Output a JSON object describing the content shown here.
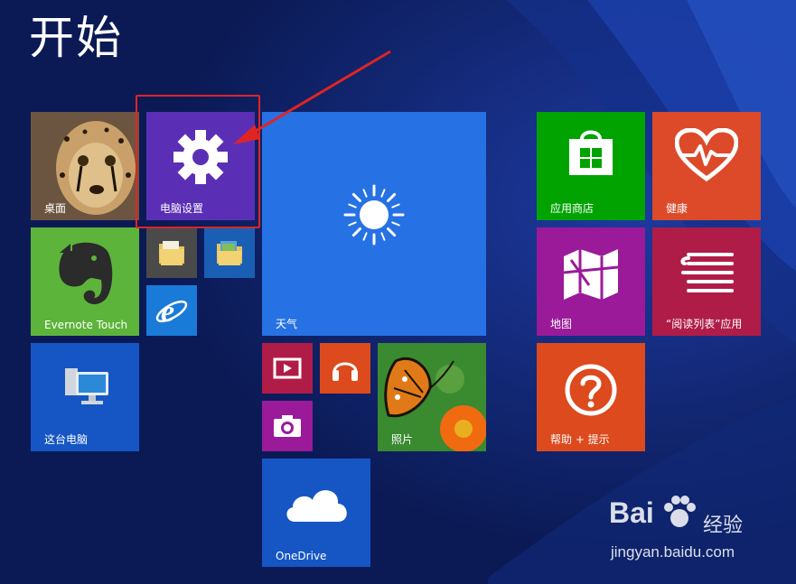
{
  "screen": {
    "title": "开始"
  },
  "tiles": {
    "desktop": {
      "label": "桌面",
      "color": "#5a4a3a"
    },
    "pc_settings": {
      "label": "电脑设置",
      "color": "#5b2fb5"
    },
    "weather": {
      "label": "天气",
      "color": "#2672e4"
    },
    "store": {
      "label": "应用商店",
      "color": "#00a300"
    },
    "health": {
      "label": "健康",
      "color": "#dc4a2a"
    },
    "evernote": {
      "label": "Evernote Touch",
      "color": "#5db43b"
    },
    "file_explorer_1": {
      "label": "",
      "color": "#4a4a4a"
    },
    "file_explorer_2": {
      "label": "",
      "color": "#1a5fb4"
    },
    "ie": {
      "label": "",
      "color": "#1a7ad8"
    },
    "maps": {
      "label": "地图",
      "color": "#9a1a9a"
    },
    "reading_list": {
      "label": "“阅读列表”应用",
      "color": "#b01c48"
    },
    "this_pc": {
      "label": "这台电脑",
      "color": "#1556c4"
    },
    "video": {
      "label": "",
      "color": "#b01c48"
    },
    "music": {
      "label": "",
      "color": "#dc4a1e"
    },
    "photos": {
      "label": "照片",
      "color": "#2e7a2e"
    },
    "camera": {
      "label": "",
      "color": "#9a1a9a"
    },
    "help": {
      "label": "帮助 + 提示",
      "color": "#dc4a1e"
    },
    "onedrive": {
      "label": "OneDrive",
      "color": "#1556c4"
    }
  },
  "annotation": {
    "highlight_color": "#e02424"
  },
  "watermark": {
    "brand": "Bai",
    "brand_suffix": "经验",
    "url": "jingyan.baidu.com"
  }
}
